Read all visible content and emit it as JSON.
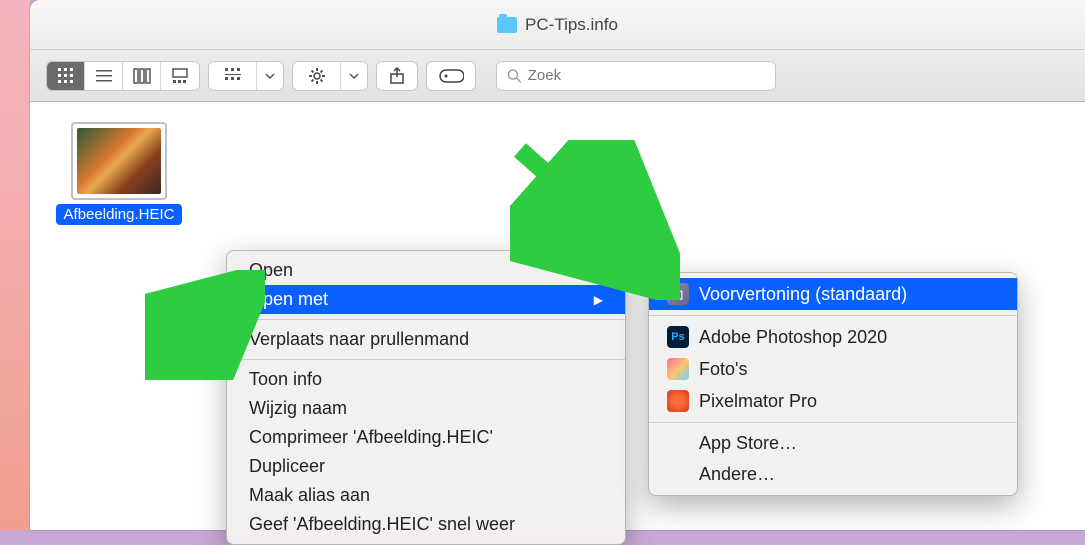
{
  "window": {
    "title": "PC-Tips.info"
  },
  "search": {
    "placeholder": "Zoek"
  },
  "file": {
    "name": "Afbeelding.HEIC"
  },
  "context_menu": {
    "items": [
      "Open",
      "Open met",
      "Verplaats naar prullenmand",
      "Toon info",
      "Wijzig naam",
      "Comprimeer 'Afbeelding.HEIC'",
      "Dupliceer",
      "Maak alias aan",
      "Geef 'Afbeelding.HEIC' snel weer"
    ]
  },
  "submenu": {
    "items": [
      "Voorvertoning (standaard)",
      "Adobe Photoshop 2020",
      "Foto's",
      "Pixelmator Pro",
      "App Store…",
      "Andere…"
    ]
  }
}
